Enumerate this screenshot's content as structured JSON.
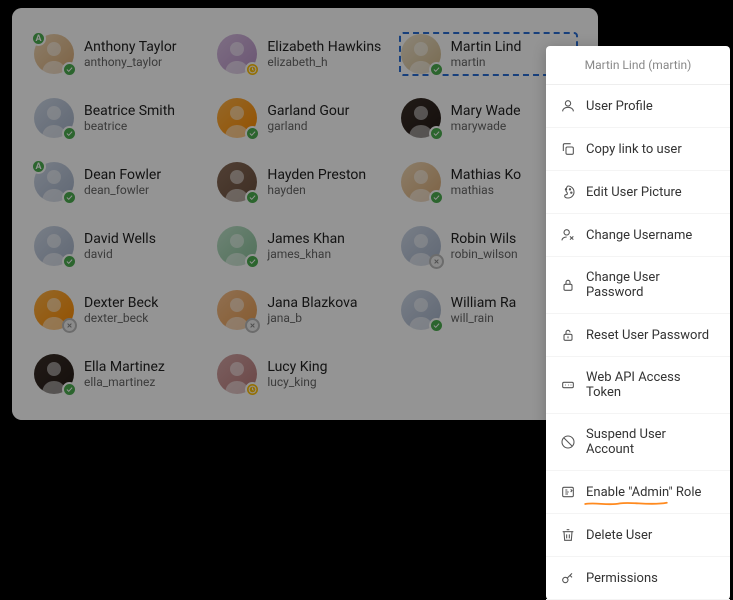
{
  "contextMenu": {
    "header": "Martin Lind (martin)",
    "items": {
      "profile": "User Profile",
      "copyLink": "Copy link to user",
      "editPicture": "Edit User Picture",
      "changeUsername": "Change Username",
      "changePassword": "Change User Password",
      "resetPassword": "Reset User Password",
      "webApi": "Web API Access Token",
      "suspend": "Suspend User Account",
      "enableAdmin": "Enable \"Admin\" Role",
      "delete": "Delete User",
      "permissions": "Permissions"
    }
  },
  "users": [
    {
      "name": "Anthony Taylor",
      "username": "anthony_taylor",
      "avatar": "c1",
      "adminBadge": true,
      "status": "green"
    },
    {
      "name": "Elizabeth Hawkins",
      "username": "elizabeth_h",
      "avatar": "c2",
      "adminBadge": false,
      "status": "yellow"
    },
    {
      "name": "Martin Lind",
      "username": "martin",
      "avatar": "c3",
      "adminBadge": false,
      "status": "green",
      "selected": true
    },
    {
      "name": "Beatrice Smith",
      "username": "beatrice",
      "avatar": "c4",
      "adminBadge": false,
      "status": "green"
    },
    {
      "name": "Garland Gour",
      "username": "garland",
      "avatar": "c5",
      "adminBadge": false,
      "status": "green"
    },
    {
      "name": "Mary Wade",
      "username": "marywade",
      "avatar": "c9",
      "adminBadge": false,
      "status": "green"
    },
    {
      "name": "Dean Fowler",
      "username": "dean_fowler",
      "avatar": "c4",
      "adminBadge": true,
      "status": "green"
    },
    {
      "name": "Hayden Preston",
      "username": "hayden",
      "avatar": "c6",
      "adminBadge": false,
      "status": "green"
    },
    {
      "name": "Mathias Ko",
      "username": "mathias",
      "avatar": "c1",
      "adminBadge": false,
      "status": "green"
    },
    {
      "name": "David Wells",
      "username": "david",
      "avatar": "c4",
      "adminBadge": false,
      "status": "green"
    },
    {
      "name": "James Khan",
      "username": "james_khan",
      "avatar": "c7",
      "adminBadge": false,
      "status": "green"
    },
    {
      "name": "Robin Wils",
      "username": "robin_wilson",
      "avatar": "c4",
      "adminBadge": false,
      "status": "gray"
    },
    {
      "name": "Dexter Beck",
      "username": "dexter_beck",
      "avatar": "c5",
      "adminBadge": false,
      "status": "gray"
    },
    {
      "name": "Jana Blazkova",
      "username": "jana_b",
      "avatar": "c8",
      "adminBadge": false,
      "status": "gray"
    },
    {
      "name": "William Ra",
      "username": "will_rain",
      "avatar": "c4",
      "adminBadge": false,
      "status": "green"
    },
    {
      "name": "Ella Martinez",
      "username": "ella_martinez",
      "avatar": "c9",
      "adminBadge": false,
      "status": "green"
    },
    {
      "name": "Lucy King",
      "username": "lucy_king",
      "avatar": "c10",
      "adminBadge": false,
      "status": "yellow"
    }
  ]
}
